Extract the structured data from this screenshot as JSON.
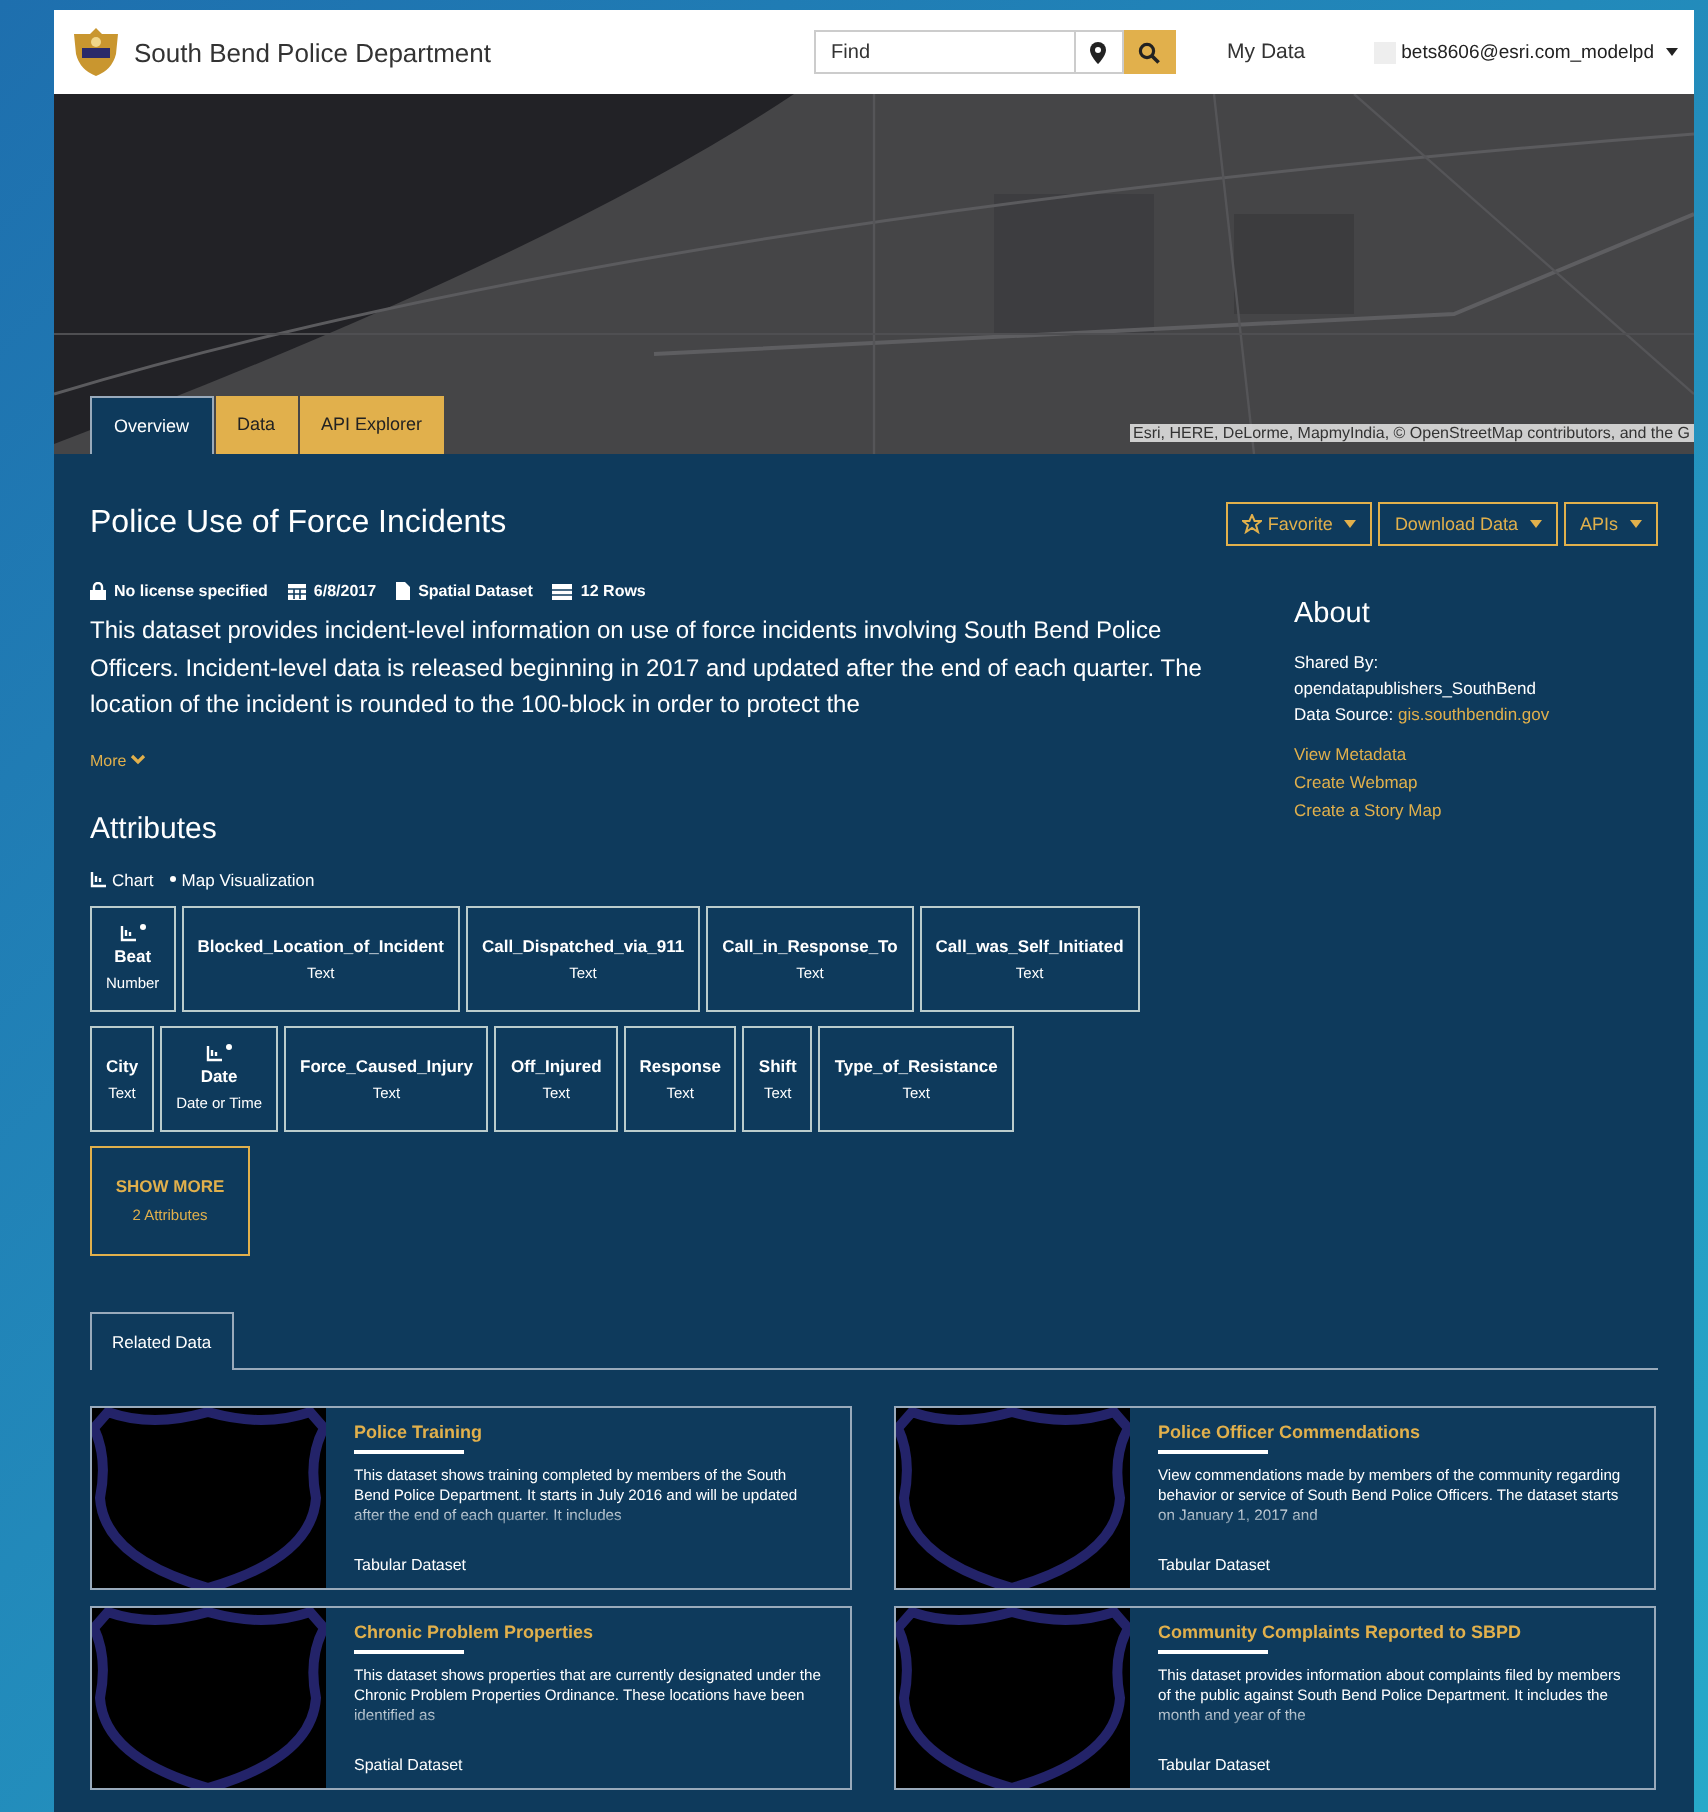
{
  "header": {
    "title": "South Bend Police Department",
    "search": {
      "placeholder": "Find"
    },
    "nav_link": "My Data",
    "user": "bets8606@esri.com_modelpd"
  },
  "map": {
    "attribution": "Esri, HERE, DeLorme, MapmyIndia, © OpenStreetMap contributors, and the G"
  },
  "tabs": [
    {
      "label": "Overview",
      "selected": true
    },
    {
      "label": "Data",
      "selected": false
    },
    {
      "label": "API Explorer",
      "selected": false
    }
  ],
  "dataset": {
    "title": "Police Use of Force Incidents",
    "actions": [
      "Favorite",
      "Download Data",
      "APIs"
    ],
    "meta": [
      {
        "kind": "lock",
        "text": "No license specified"
      },
      {
        "kind": "calendar",
        "text": "6/8/2017"
      },
      {
        "kind": "file",
        "text": "Spatial Dataset"
      },
      {
        "kind": "rows",
        "text": "12 Rows"
      }
    ],
    "description": "This dataset provides incident-level information on use of force incidents involving South Bend Police Officers. Incident-level data is released beginning in 2017 and updated after the end of each quarter. The location of the incident is rounded to the 100-block in order to protect the",
    "more": "More"
  },
  "about": {
    "title": "About",
    "shared_by_label": "Shared By:",
    "shared_by": "opendatapublishers_SouthBend",
    "source_label": "Data Source:",
    "source": "gis.southbendin.gov",
    "links": [
      "View Metadata",
      "Create Webmap",
      "Create a Story Map"
    ]
  },
  "attributes": {
    "title": "Attributes",
    "legend": [
      {
        "kind": "chart",
        "text": "Chart"
      },
      {
        "kind": "map",
        "text": "Map Visualization"
      }
    ],
    "items": [
      {
        "name": "Beat",
        "type": "Number",
        "charted": true
      },
      {
        "name": "Blocked_Location_of_Incident",
        "type": "Text",
        "charted": false
      },
      {
        "name": "Call_Dispatched_via_911",
        "type": "Text",
        "charted": false
      },
      {
        "name": "Call_in_Response_To",
        "type": "Text",
        "charted": false
      },
      {
        "name": "Call_was_Self_Initiated",
        "type": "Text",
        "charted": false
      },
      {
        "name": "City",
        "type": "Text",
        "charted": false
      },
      {
        "name": "Date",
        "type": "Date or Time",
        "charted": true
      },
      {
        "name": "Force_Caused_Injury",
        "type": "Text",
        "charted": false
      },
      {
        "name": "Off_Injured",
        "type": "Text",
        "charted": false
      },
      {
        "name": "Response",
        "type": "Text",
        "charted": false
      },
      {
        "name": "Shift",
        "type": "Text",
        "charted": false
      },
      {
        "name": "Type_of_Resistance",
        "type": "Text",
        "charted": false
      }
    ],
    "show_more": {
      "label": "SHOW MORE",
      "count": "2 Attributes"
    }
  },
  "related": {
    "tab": "Related Data",
    "items": [
      {
        "title": "Police Training",
        "description": "This dataset shows training completed by members of the South Bend Police Department. It starts in July 2016 and will be updated after the end of each quarter. It includes",
        "type": "Tabular Dataset"
      },
      {
        "title": "Police Officer Commendations",
        "description": "View commendations made by members of the community regarding behavior or service of South Bend Police Officers. The dataset starts on January 1, 2017 and",
        "type": "Tabular Dataset"
      },
      {
        "title": "Chronic Problem Properties",
        "description": "This dataset shows properties that are currently designated under the Chronic Problem Properties Ordinance. These locations have been identified as",
        "type": "Spatial Dataset"
      },
      {
        "title": "Community Complaints Reported to SBPD",
        "description": "This dataset provides information about complaints filed by members of the public against South Bend Police Department. It includes the month and year of the",
        "type": "Tabular Dataset"
      }
    ]
  }
}
